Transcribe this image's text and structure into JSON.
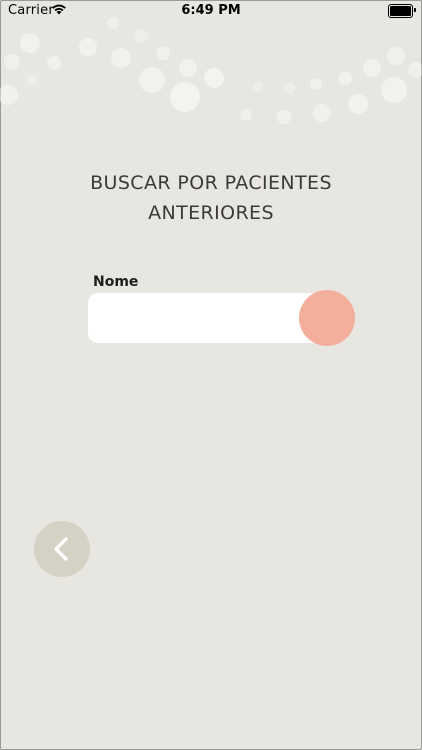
{
  "status_bar": {
    "carrier": "Carrier",
    "time": "6:49 PM",
    "icons": [
      "wifi-icon",
      "battery-icon"
    ]
  },
  "page": {
    "title_line1": "BUSCAR POR PACIENTES",
    "title_line2": "ANTERIORES"
  },
  "search_form": {
    "label": "Nome",
    "value": "",
    "placeholder": ""
  },
  "buttons": {
    "search_icon": "circle-button",
    "back_icon": "chevron-left-icon"
  },
  "colors": {
    "background": "#e8e6e0",
    "accent": "#f4ae9c",
    "back_button": "#d5d1c4",
    "title": "#3c3a37"
  }
}
